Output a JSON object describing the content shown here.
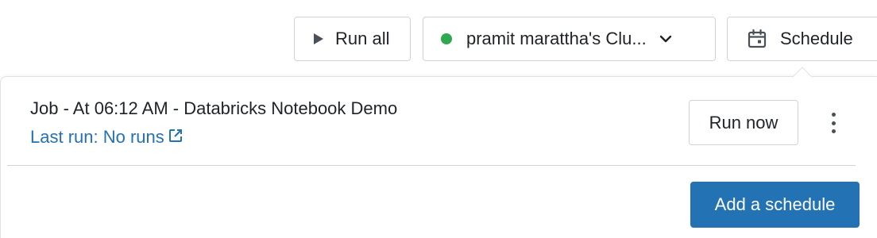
{
  "toolbar": {
    "run_all_label": "Run all",
    "cluster_name": "pramit marattha's Clu...",
    "cluster_status_color": "#2fa84f",
    "schedule_label": "Schedule"
  },
  "schedule_panel": {
    "job": {
      "title": "Job - At 06:12 AM - Databricks Notebook Demo",
      "last_run": "Last run: No runs",
      "run_now_label": "Run now"
    },
    "add_schedule_label": "Add a schedule"
  },
  "colors": {
    "accent": "#2272b4",
    "link": "#2272b4"
  },
  "icons": [
    "play-icon",
    "status-dot-icon",
    "chevron-down-icon",
    "calendar-icon",
    "external-link-icon",
    "kebab-menu-icon"
  ]
}
